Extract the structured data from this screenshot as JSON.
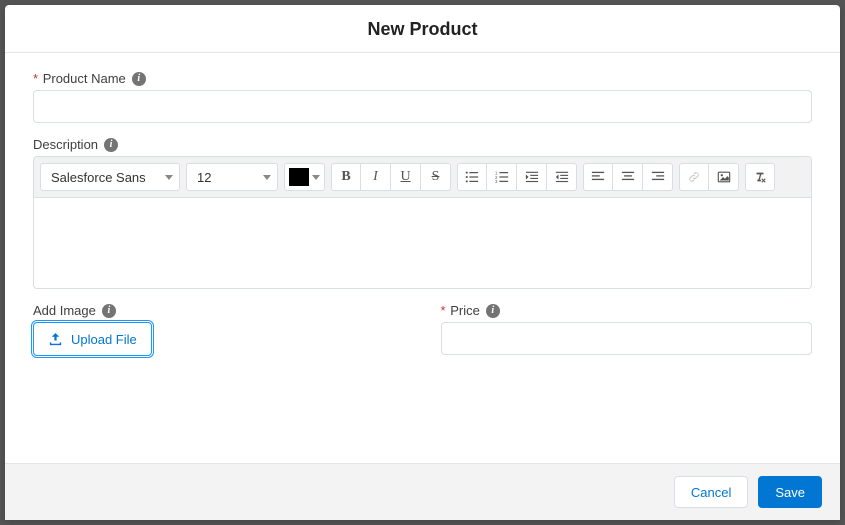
{
  "header": {
    "title": "New Product"
  },
  "fields": {
    "product_name": {
      "label": "Product Name",
      "required": true,
      "value": ""
    },
    "description": {
      "label": "Description"
    },
    "add_image": {
      "label": "Add Image",
      "button": "Upload File"
    },
    "price": {
      "label": "Price",
      "required": true,
      "value": ""
    }
  },
  "rte": {
    "font": {
      "selected": "Salesforce Sans"
    },
    "size": {
      "selected": "12"
    },
    "color": "#000000"
  },
  "footer": {
    "cancel": "Cancel",
    "save": "Save"
  }
}
